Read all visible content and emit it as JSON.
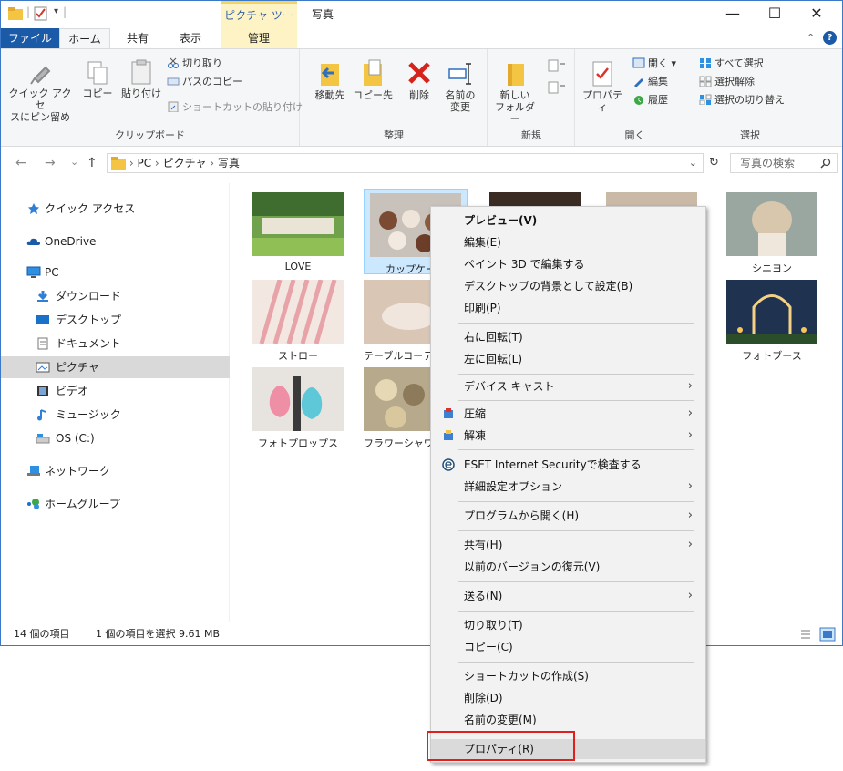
{
  "titlebar": {
    "context_tab_header": "ピクチャ ツール",
    "title": "写真",
    "minimize": "—",
    "maximize": "☐",
    "close": "✕"
  },
  "ribbon_tabs": {
    "file": "ファイル",
    "home": "ホーム",
    "share": "共有",
    "view": "表示",
    "manage": "管理",
    "help": "?"
  },
  "ribbon": {
    "clipboard": {
      "label": "クリップボード",
      "pin_line1": "クイック アクセ",
      "pin_line2": "スにピン留め",
      "copy": "コピー",
      "paste": "貼り付け",
      "cut": "切り取り",
      "copy_path": "パスのコピー",
      "paste_shortcut": "ショートカットの貼り付け"
    },
    "organize": {
      "label": "整理",
      "move_to": "移動先",
      "copy_to": "コピー先",
      "delete": "削除",
      "rename_line1": "名前の",
      "rename_line2": "変更"
    },
    "new": {
      "label": "新規",
      "new_folder_line1": "新しい",
      "new_folder_line2": "フォルダー"
    },
    "open": {
      "label": "開く",
      "properties": "プロパティ",
      "open": "開く",
      "edit": "編集",
      "history": "履歴"
    },
    "select": {
      "label": "選択",
      "select_all": "すべて選択",
      "select_none": "選択解除",
      "invert": "選択の切り替え"
    }
  },
  "address": {
    "back": "←",
    "forward": "→",
    "recent": "⌄",
    "up": "↑",
    "path": [
      "PC",
      "ピクチャ",
      "写真"
    ],
    "refresh": "↻",
    "dropdown": "⌄",
    "search_placeholder": "写真の検索"
  },
  "sidebar": {
    "items": [
      {
        "label": "クイック アクセス"
      },
      {
        "label": "OneDrive"
      },
      {
        "label": "PC"
      },
      {
        "label": "ダウンロード"
      },
      {
        "label": "デスクトップ"
      },
      {
        "label": "ドキュメント"
      },
      {
        "label": "ピクチャ"
      },
      {
        "label": "ビデオ"
      },
      {
        "label": "ミュージック"
      },
      {
        "label": "OS (C:)"
      },
      {
        "label": "ネットワーク"
      },
      {
        "label": "ホームグループ"
      }
    ]
  },
  "files": [
    {
      "name": "LOVE"
    },
    {
      "name": "カップケーキ"
    },
    {
      "name": "シニヨン"
    },
    {
      "name": "ストロー"
    },
    {
      "name": "テーブルコーディネート"
    },
    {
      "name": "フォトブース"
    },
    {
      "name": "フォトプロップス"
    },
    {
      "name": "フラワーシャワー"
    }
  ],
  "status": {
    "count": "14 個の項目",
    "selected": "1 個の項目を選択  9.61 MB"
  },
  "context_menu": {
    "items": [
      {
        "label": "プレビュー(V)"
      },
      {
        "label": "編集(E)"
      },
      {
        "label": "ペイント 3D で編集する"
      },
      {
        "label": "デスクトップの背景として設定(B)"
      },
      {
        "label": "印刷(P)"
      },
      {
        "label": "右に回転(T)"
      },
      {
        "label": "左に回転(L)"
      },
      {
        "label": "デバイス キャスト"
      },
      {
        "label": "圧縮"
      },
      {
        "label": "解凍"
      },
      {
        "label": "ESET Internet Securityで検査する"
      },
      {
        "label": "詳細設定オプション"
      },
      {
        "label": "プログラムから開く(H)"
      },
      {
        "label": "共有(H)"
      },
      {
        "label": "以前のバージョンの復元(V)"
      },
      {
        "label": "送る(N)"
      },
      {
        "label": "切り取り(T)"
      },
      {
        "label": "コピー(C)"
      },
      {
        "label": "ショートカットの作成(S)"
      },
      {
        "label": "削除(D)"
      },
      {
        "label": "名前の変更(M)"
      },
      {
        "label": "プロパティ(R)"
      }
    ],
    "submenu_arrow": "›"
  },
  "colors": {
    "file_tab": "#1a5aa6",
    "context_tab": "#fdf3c5",
    "selection": "#cce8ff",
    "highlight_box": "#e0201e"
  }
}
